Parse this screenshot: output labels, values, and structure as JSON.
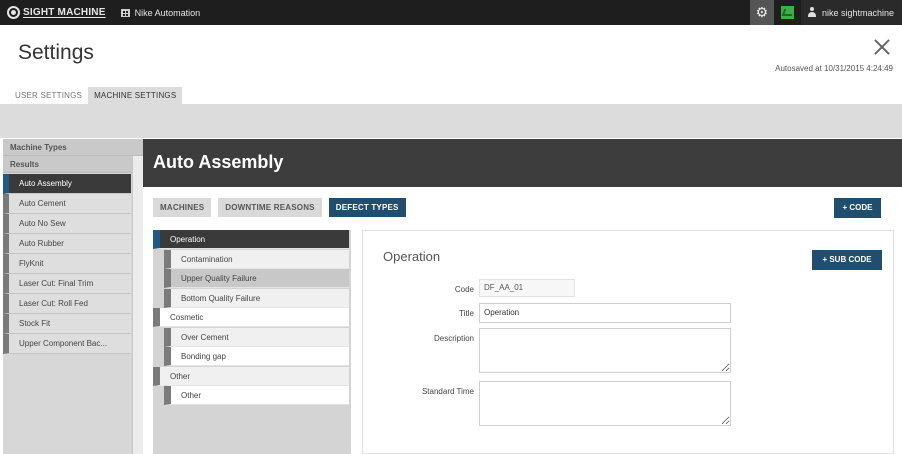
{
  "topbar": {
    "brand": "SIGHT MACHINE",
    "company": "Nike Automation",
    "user": "nike sightmachine",
    "icons": {
      "settings": "gear-icon",
      "status": "chart-icon",
      "user": "person-icon"
    },
    "status_color": "#3db043"
  },
  "header": {
    "title": "Settings",
    "autosave": "Autosaved at 10/31/2015 4:24:49"
  },
  "main_tabs": [
    {
      "label": "USER SETTINGS",
      "active": false
    },
    {
      "label": "MACHINE SETTINGS",
      "active": true
    }
  ],
  "sidebar": {
    "sections": [
      "Machine Types",
      "Results"
    ],
    "items": [
      {
        "label": "Auto Assembly",
        "active": true
      },
      {
        "label": "Auto Cement"
      },
      {
        "label": "Auto No Sew"
      },
      {
        "label": "Auto Rubber"
      },
      {
        "label": "FlyKnit"
      },
      {
        "label": "Laser Cut: Final Trim"
      },
      {
        "label": "Laser Cut: Roll Fed"
      },
      {
        "label": "Stock Fit"
      },
      {
        "label": "Upper Component Bac..."
      }
    ]
  },
  "content": {
    "title": "Auto Assembly",
    "sub_tabs": [
      {
        "label": "MACHINES"
      },
      {
        "label": "DOWNTIME REASONS"
      },
      {
        "label": "DEFECT TYPES",
        "active": true
      }
    ],
    "add_code_label": "+ CODE",
    "tree": [
      {
        "label": "Operation",
        "level": 0,
        "selected": true
      },
      {
        "label": "Contamination",
        "level": 1
      },
      {
        "label": "Upper Quality Failure",
        "level": 1,
        "hover": true
      },
      {
        "label": "Bottom Quality Failure",
        "level": 1
      },
      {
        "label": "Cosmetic",
        "level": 0
      },
      {
        "label": "Over Cement",
        "level": 1
      },
      {
        "label": "Bonding gap",
        "level": 1
      },
      {
        "label": "Other",
        "level": 0
      },
      {
        "label": "Other",
        "level": 1
      }
    ]
  },
  "panel": {
    "title": "Operation",
    "add_subcode_label": "+ SUB CODE",
    "fields": {
      "code_label": "Code",
      "code_value": "DF_AA_01",
      "title_label": "Title",
      "title_value": "Operation",
      "description_label": "Description",
      "description_value": "",
      "standard_time_label": "Standard Time",
      "standard_time_value": ""
    }
  },
  "colors": {
    "accent": "#1f4e71",
    "selection_bar": "#1f5b85",
    "header_bg": "#3d3d3d",
    "topbar_bg": "#1e1e1e"
  }
}
